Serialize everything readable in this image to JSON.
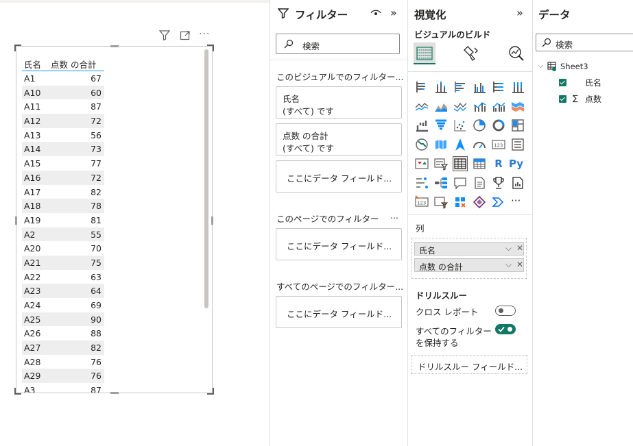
{
  "visual": {
    "columns": [
      "氏名",
      "点数 の合計"
    ],
    "rows": [
      [
        "A1",
        "67"
      ],
      [
        "A10",
        "60"
      ],
      [
        "A11",
        "87"
      ],
      [
        "A12",
        "72"
      ],
      [
        "A13",
        "56"
      ],
      [
        "A14",
        "73"
      ],
      [
        "A15",
        "77"
      ],
      [
        "A16",
        "72"
      ],
      [
        "A17",
        "82"
      ],
      [
        "A18",
        "78"
      ],
      [
        "A19",
        "81"
      ],
      [
        "A2",
        "55"
      ],
      [
        "A20",
        "70"
      ],
      [
        "A21",
        "75"
      ],
      [
        "A22",
        "63"
      ],
      [
        "A23",
        "64"
      ],
      [
        "A24",
        "69"
      ],
      [
        "A25",
        "90"
      ],
      [
        "A26",
        "88"
      ],
      [
        "A27",
        "82"
      ],
      [
        "A28",
        "76"
      ],
      [
        "A29",
        "76"
      ],
      [
        "A3",
        "87"
      ]
    ],
    "header_icons": [
      "filter-icon",
      "focus-mode-icon",
      "more-options-icon"
    ]
  },
  "filters": {
    "title": "フィルター",
    "search_placeholder": "検索",
    "visual_section": "このビジュアルでのフィルター...",
    "cards": [
      {
        "field": "氏名",
        "state": "(すべて) です"
      },
      {
        "field": "点数 の合計",
        "state": "(すべて) です"
      }
    ],
    "drop_here": "ここにデータ フィールド...",
    "page_section": "このページでのフィルター",
    "page_more": "...",
    "all_pages_section": "すべてのページでのフィルター..."
  },
  "viz": {
    "title": "視覚化",
    "build_label": "ビジュアルのビルド",
    "well_label": "列",
    "well_fields": [
      "氏名",
      "点数 の合計"
    ],
    "drill_title": "ドリルスルー",
    "cross_report": "クロス レポート",
    "keep_filters_1": "すべてのフィルター",
    "keep_filters_2": "を保持する",
    "drill_drop": "ドリルスルー フィールド...",
    "r_label": "R",
    "py_label": "Py",
    "more_label": "···"
  },
  "data": {
    "title": "データ",
    "search_placeholder": "検索",
    "table": "Sheet3",
    "fields": [
      {
        "name": "氏名",
        "sigma": ""
      },
      {
        "name": "点数",
        "sigma": "∑"
      }
    ]
  },
  "colors": {
    "accent": "#117865",
    "selection": "#118dff",
    "border": "#c8c6c4"
  }
}
